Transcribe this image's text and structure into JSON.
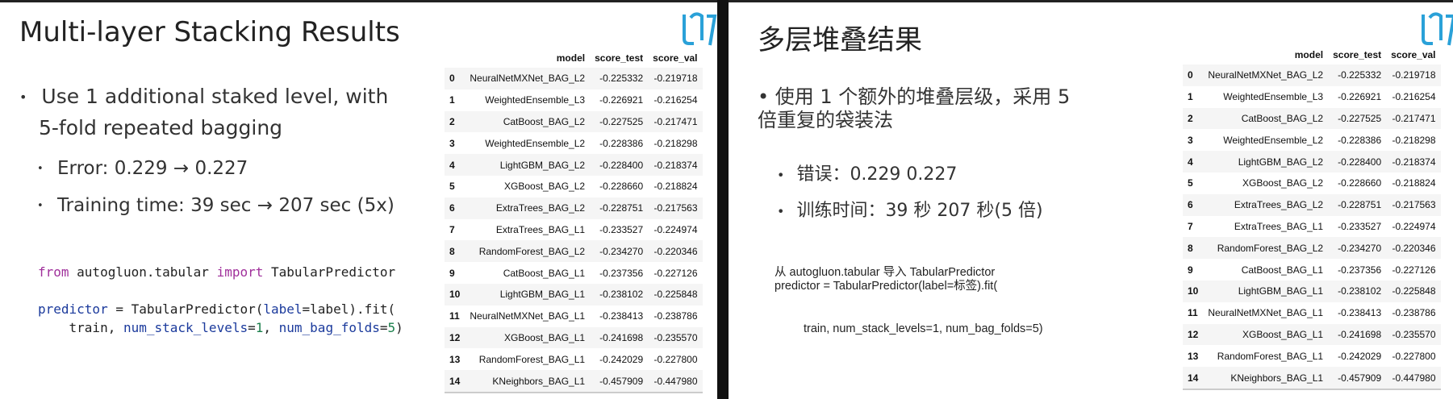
{
  "left": {
    "title": "Multi-layer Stacking Results",
    "bullet1_line1": "Use 1 additional staked level,  with",
    "bullet1_line2": "5-fold repeated bagging",
    "sub1": "Error: 0.229 → 0.227",
    "sub2": "Training time: 39 sec → 207 sec (5x)",
    "code": {
      "l1_from": "from",
      "l1_mod": " autogluon.tabular ",
      "l1_import": "import",
      "l1_cls": " TabularPredictor",
      "l2_a": "predictor",
      "l2_b": " = TabularPredictor(",
      "l2_c": "label",
      "l2_d": "=label).fit(",
      "l3_a": "    train, ",
      "l3_b": "num_stack_levels",
      "l3_c": "=",
      "l3_d": "1",
      "l3_e": ", ",
      "l3_f": "num_bag_folds",
      "l3_g": "=",
      "l3_h": "5",
      "l3_i": ")"
    }
  },
  "right": {
    "title": "多层堆叠结果",
    "bullet1_line1": "• 使用 1 个额外的堆叠层级，采用 5",
    "bullet1_line2": "倍重复的袋装法",
    "sub1": "错误：0.229 0.227",
    "sub2": "训练时间：39 秒 207 秒(5 倍)",
    "code1": "从 autogluon.tabular 导入 TabularPredictor",
    "code2": "predictor = TabularPredictor(label=标签).fit(",
    "code3": "train, num_stack_levels=1, num_bag_folds=5)"
  },
  "table": {
    "headers": [
      "",
      "model",
      "score_test",
      "score_val"
    ],
    "rows": [
      [
        "0",
        "NeuralNetMXNet_BAG_L2",
        "-0.225332",
        "-0.219718"
      ],
      [
        "1",
        "WeightedEnsemble_L3",
        "-0.226921",
        "-0.216254"
      ],
      [
        "2",
        "CatBoost_BAG_L2",
        "-0.227525",
        "-0.217471"
      ],
      [
        "3",
        "WeightedEnsemble_L2",
        "-0.228386",
        "-0.218298"
      ],
      [
        "4",
        "LightGBM_BAG_L2",
        "-0.228400",
        "-0.218374"
      ],
      [
        "5",
        "XGBoost_BAG_L2",
        "-0.228660",
        "-0.218824"
      ],
      [
        "6",
        "ExtraTrees_BAG_L2",
        "-0.228751",
        "-0.217563"
      ],
      [
        "7",
        "ExtraTrees_BAG_L1",
        "-0.233527",
        "-0.224974"
      ],
      [
        "8",
        "RandomForest_BAG_L2",
        "-0.234270",
        "-0.220346"
      ],
      [
        "9",
        "CatBoost_BAG_L1",
        "-0.237356",
        "-0.227126"
      ],
      [
        "10",
        "LightGBM_BAG_L1",
        "-0.238102",
        "-0.225848"
      ],
      [
        "11",
        "NeuralNetMXNet_BAG_L1",
        "-0.238413",
        "-0.238786"
      ],
      [
        "12",
        "XGBoost_BAG_L1",
        "-0.241698",
        "-0.235570"
      ],
      [
        "13",
        "RandomForest_BAG_L1",
        "-0.242029",
        "-0.227800"
      ],
      [
        "14",
        "KNeighbors_BAG_L1",
        "-0.457909",
        "-0.447980"
      ]
    ]
  },
  "icons": {
    "logo": "aws-logo-icon"
  },
  "colors": {
    "keyword": "#a0309b",
    "number": "#1a7f4b",
    "param": "#1b3a9c",
    "logo": "#2aa1d8"
  }
}
